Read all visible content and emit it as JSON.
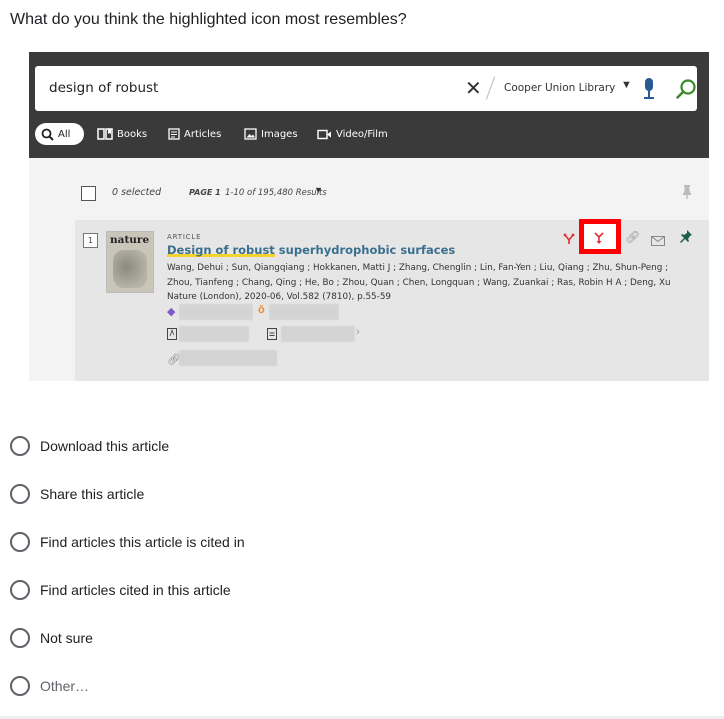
{
  "question": "What do you think the highlighted icon most resembles?",
  "search": {
    "query": "design of robust",
    "scope": "Cooper Union Library"
  },
  "tabs": [
    {
      "label": "All",
      "icon": "search-icon"
    },
    {
      "label": "Books",
      "icon": "book-icon"
    },
    {
      "label": "Articles",
      "icon": "article-icon"
    },
    {
      "label": "Images",
      "icon": "image-icon"
    },
    {
      "label": "Video/Film",
      "icon": "video-icon"
    }
  ],
  "results_bar": {
    "selected": "0 selected",
    "page": "PAGE 1",
    "count": "1-10 of 195,480 Results"
  },
  "record": {
    "number": "1",
    "thumb_title": "nature",
    "type": "ARTICLE",
    "title_highlight": "Design of robust",
    "title_rest": " superhydrophobic surfaces",
    "authors_line1": "Wang, Dehui ; Sun, Qiangqiang ; Hokkanen, Matti J ; Zhang, Chenglin ; Lin, Fan-Yen ; Liu, Qiang ; Zhu, Shun-Peng ;",
    "authors_line2": "Zhou, Tianfeng ; Chang, Qing ; He, Bo ; Zhou, Quan ; Chen, Longquan ; Wang, Zuankai ; Ras, Robin H A ; Deng, Xu",
    "source": "Nature (London), 2020-06, Vol.582 (7810), p.55-59",
    "actions": [
      "citing-icon",
      "cited-by-icon",
      "link-icon",
      "email-icon",
      "pin-icon"
    ],
    "highlight_color": "#ff0000",
    "title_color": "#3b6f8e"
  },
  "options": [
    {
      "label": "Download this article"
    },
    {
      "label": "Share this article"
    },
    {
      "label": "Find articles this article is cited in"
    },
    {
      "label": "Find articles cited in this article"
    },
    {
      "label": "Not sure"
    },
    {
      "label": "Other…"
    }
  ]
}
